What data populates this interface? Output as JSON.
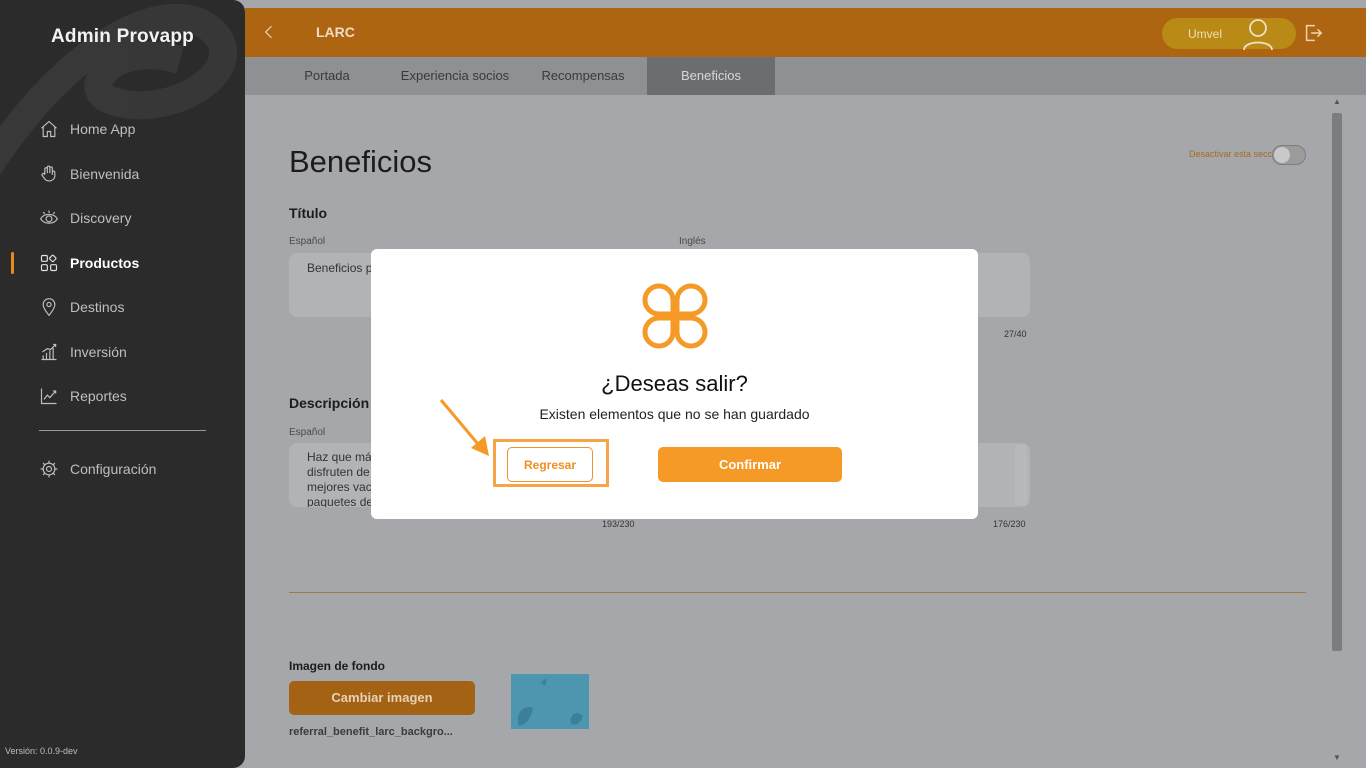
{
  "sidebar": {
    "brand": "Admin Provapp",
    "items": [
      {
        "label": "Home App",
        "icon": "home-icon"
      },
      {
        "label": "Bienvenida",
        "icon": "wave-hand-icon"
      },
      {
        "label": "Discovery",
        "icon": "eye-icon"
      },
      {
        "label": "Productos",
        "icon": "grid-icon",
        "active": true
      },
      {
        "label": "Destinos",
        "icon": "location-pin-icon"
      },
      {
        "label": "Inversión",
        "icon": "bar-chart-icon"
      },
      {
        "label": "Reportes",
        "icon": "line-chart-icon"
      }
    ],
    "config_label": "Configuración",
    "version": "Versión: 0.0.9-dev"
  },
  "topbar": {
    "title": "LARC",
    "user_name": "Umvel"
  },
  "tabs": [
    {
      "label": "Portada"
    },
    {
      "label": "Experiencia socios"
    },
    {
      "label": "Recompensas"
    },
    {
      "label": "Beneficios",
      "active": true
    }
  ],
  "main": {
    "title": "Beneficios",
    "deactivate_label": "Desactivar esta seccion",
    "title_section": {
      "label": "Título",
      "spanish_label": "Español",
      "english_label": "Inglés",
      "spanish_value": "Beneficios p",
      "english_counter": "27/40"
    },
    "description_section": {
      "label": "Descripción",
      "spanish_label": "Español",
      "spanish_lines": [
        "Haz que má",
        "disfruten de",
        "mejores vac",
        "paquetes de"
      ],
      "spanish_counter": "193/230",
      "english_counter": "176/230"
    },
    "image_section": {
      "label": "Imagen de fondo",
      "button_label": "Cambiar imagen",
      "file_name": "referral_benefit_larc_backgro..."
    }
  },
  "modal": {
    "title": "¿Deseas salir?",
    "subtitle": "Existen elementos que no se han guardado",
    "back_label": "Regresar",
    "confirm_label": "Confirmar"
  },
  "colors": {
    "accent": "#f59a26",
    "topbar": "#ae6511",
    "sidebar": "#2b2b2b"
  }
}
